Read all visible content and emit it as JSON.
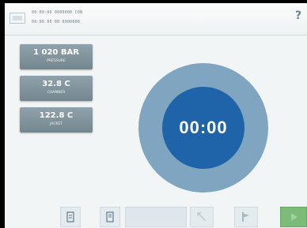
{
  "header": {
    "line1": "00:00:00 0000000 CON",
    "line2": "00:00 00 00 0000000",
    "help_icon": "?"
  },
  "stats": [
    {
      "value": "1 020 BAR",
      "label": "PRESSURE"
    },
    {
      "value": "32.8 C",
      "label": "CHAMBER"
    },
    {
      "value": "122.8 C",
      "label": "JACKET"
    }
  ],
  "timer": {
    "display": "00:00"
  },
  "colors": {
    "timer_outer": "#7fa5c1",
    "timer_inner": "#1f64a8",
    "stat_tile": "#7d9099",
    "start_button": "#7dbb7a"
  },
  "bottom_bar": {
    "icons": [
      "door-icon",
      "book-icon",
      "blank",
      "expand-icon",
      "flag-icon",
      "play-icon"
    ]
  }
}
